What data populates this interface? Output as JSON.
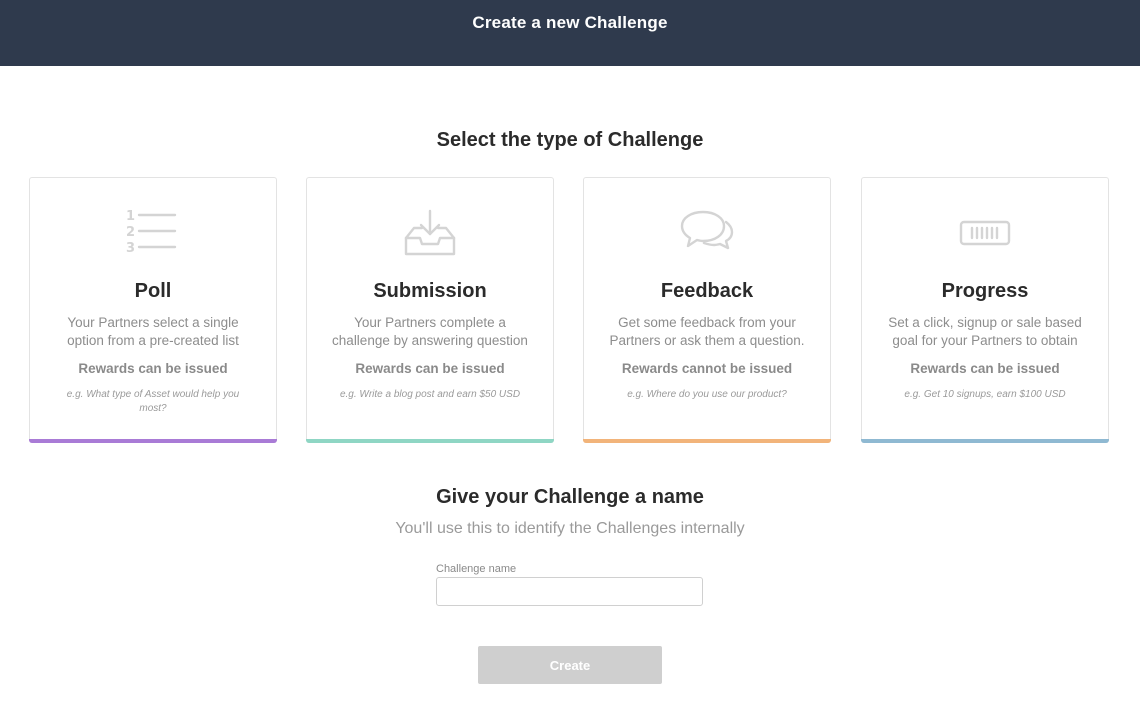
{
  "header": {
    "title": "Create a new Challenge"
  },
  "type_section": {
    "title": "Select the type of Challenge"
  },
  "cards": [
    {
      "title": "Poll",
      "description": "Your Partners select a single option from a pre-created list",
      "reward": "Rewards can be issued",
      "example": "e.g. What type of Asset would help you most?",
      "icon": "numbered-list-icon",
      "accent": "#a97bd6"
    },
    {
      "title": "Submission",
      "description": "Your Partners complete a challenge by answering question",
      "reward": "Rewards can be issued",
      "example": "e.g. Write a blog post and earn $50 USD",
      "icon": "inbox-download-icon",
      "accent": "#8fd6c4"
    },
    {
      "title": "Feedback",
      "description": "Get some feedback from your Partners or ask them a question.",
      "reward": "Rewards cannot be issued",
      "example": "e.g. Where do you use our product?",
      "icon": "chat-bubbles-icon",
      "accent": "#f2b47a"
    },
    {
      "title": "Progress",
      "description": "Set a click, signup or sale based goal for your Partners to obtain",
      "reward": "Rewards can be issued",
      "example": "e.g. Get 10 signups, earn $100 USD",
      "icon": "progress-bar-icon",
      "accent": "#8fb9d2"
    }
  ],
  "name_section": {
    "title": "Give your Challenge a name",
    "subtitle": "You'll use this to identify the Challenges internally",
    "field_label": "Challenge name",
    "field_value": "",
    "field_placeholder": ""
  },
  "actions": {
    "create_label": "Create"
  },
  "colors": {
    "header_bg": "#2f3a4d",
    "button_disabled": "#cfcfcf",
    "icon_stroke": "#cfcfcf"
  }
}
